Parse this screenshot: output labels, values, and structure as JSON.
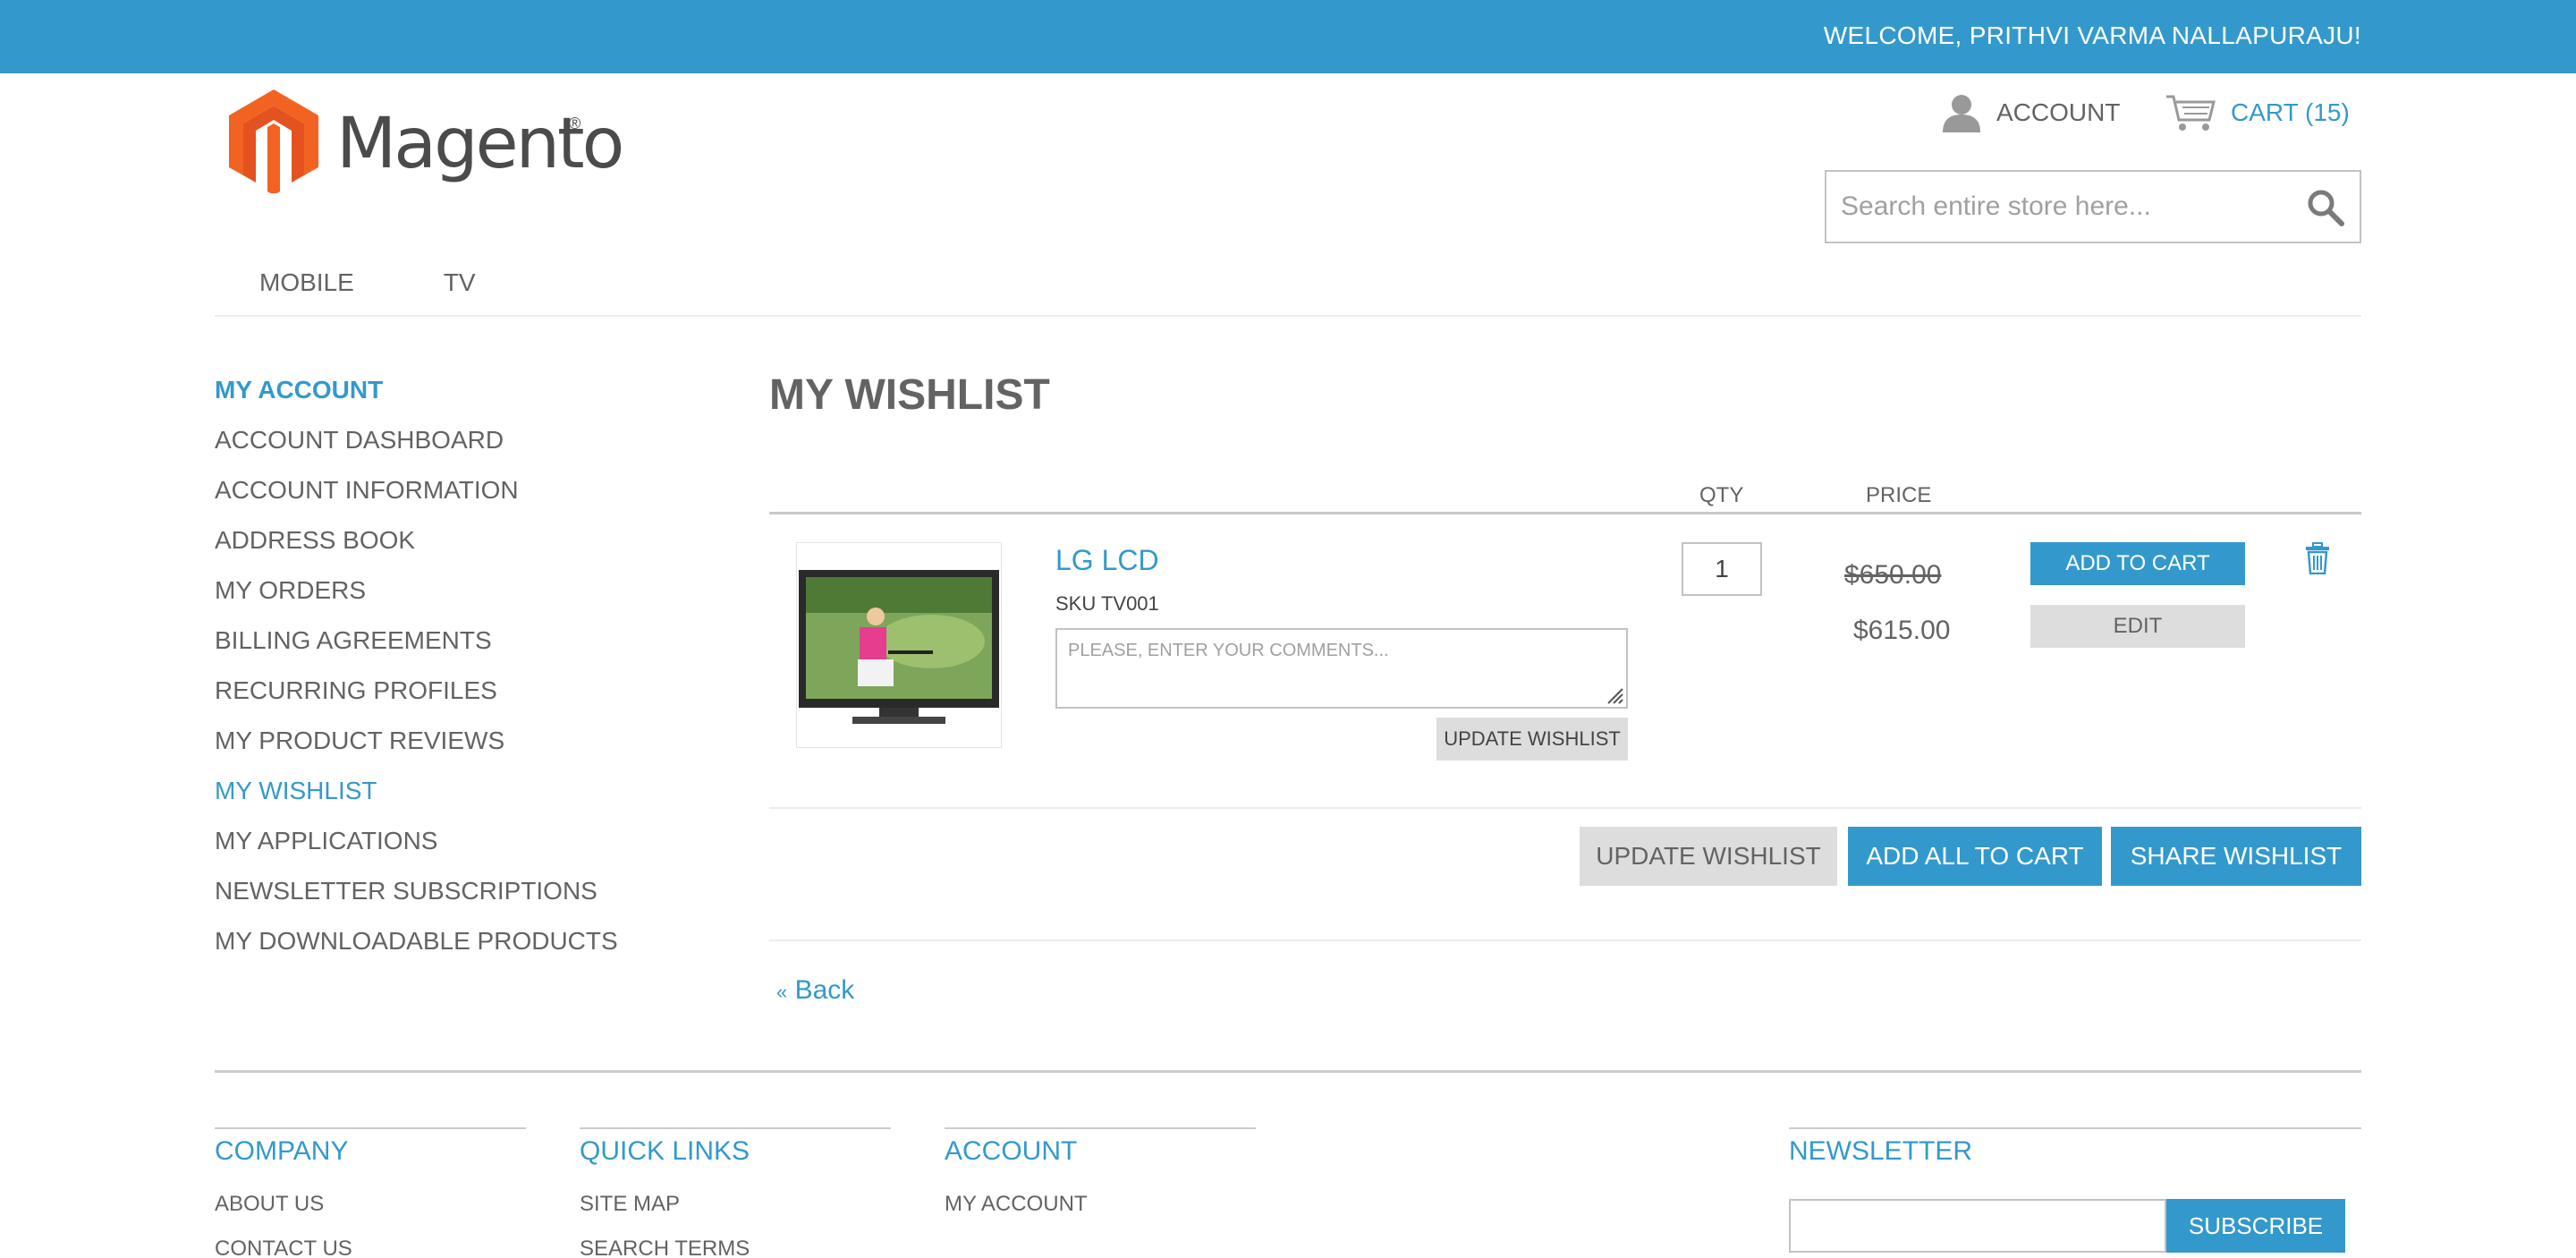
{
  "header": {
    "welcome": "WELCOME, PRITHVI VARMA NALLAPURAJU!",
    "logo_text": "Magento",
    "logo_reg": "®",
    "account_label": "ACCOUNT",
    "cart_label": "CART (15)",
    "search_placeholder": "Search entire store here...",
    "search_value": ""
  },
  "nav": {
    "items": [
      {
        "label": "MOBILE"
      },
      {
        "label": "TV"
      }
    ]
  },
  "sidebar": {
    "title": "MY ACCOUNT",
    "items": [
      {
        "label": "ACCOUNT DASHBOARD"
      },
      {
        "label": "ACCOUNT INFORMATION"
      },
      {
        "label": "ADDRESS BOOK"
      },
      {
        "label": "MY ORDERS"
      },
      {
        "label": "BILLING AGREEMENTS"
      },
      {
        "label": "RECURRING PROFILES"
      },
      {
        "label": "MY PRODUCT REVIEWS"
      },
      {
        "label": "MY WISHLIST"
      },
      {
        "label": "MY APPLICATIONS"
      },
      {
        "label": "NEWSLETTER SUBSCRIPTIONS"
      },
      {
        "label": "MY DOWNLOADABLE PRODUCTS"
      }
    ],
    "active_item": "MY WISHLIST"
  },
  "wishlist": {
    "title": "MY WISHLIST",
    "columns": {
      "qty": "QTY",
      "price": "PRICE"
    },
    "items": [
      {
        "name": "LG LCD",
        "sku": "SKU TV001",
        "comment_placeholder": "PLEASE, ENTER YOUR COMMENTS...",
        "comment_value": "",
        "update_label": "UPDATE WISHLIST",
        "qty": "1",
        "old_price": "$650.00",
        "price": "$615.00",
        "add_to_cart_label": "ADD TO CART",
        "edit_label": "EDIT"
      }
    ],
    "actions": {
      "update_label": "UPDATE WISHLIST",
      "add_all_label": "ADD ALL TO CART",
      "share_label": "SHARE WISHLIST"
    },
    "back_arrow": "«",
    "back_label": "Back"
  },
  "footer": {
    "columns": [
      {
        "title": "COMPANY",
        "links": [
          "ABOUT US",
          "CONTACT US"
        ]
      },
      {
        "title": "QUICK LINKS",
        "links": [
          "SITE MAP",
          "SEARCH TERMS"
        ]
      },
      {
        "title": "ACCOUNT",
        "links": [
          "MY ACCOUNT"
        ]
      }
    ],
    "newsletter": {
      "title": "NEWSLETTER",
      "input_value": "",
      "button_label": "SUBSCRIBE"
    }
  },
  "colors": {
    "brand_blue": "#3399cc",
    "logo_orange": "#f26322",
    "text_grey": "#636363",
    "button_grey": "#dddddd"
  },
  "icons": {
    "account": "person-icon",
    "cart": "cart-icon",
    "search": "magnifier-icon",
    "remove": "trash-icon",
    "resize": "resize-grip-icon"
  }
}
